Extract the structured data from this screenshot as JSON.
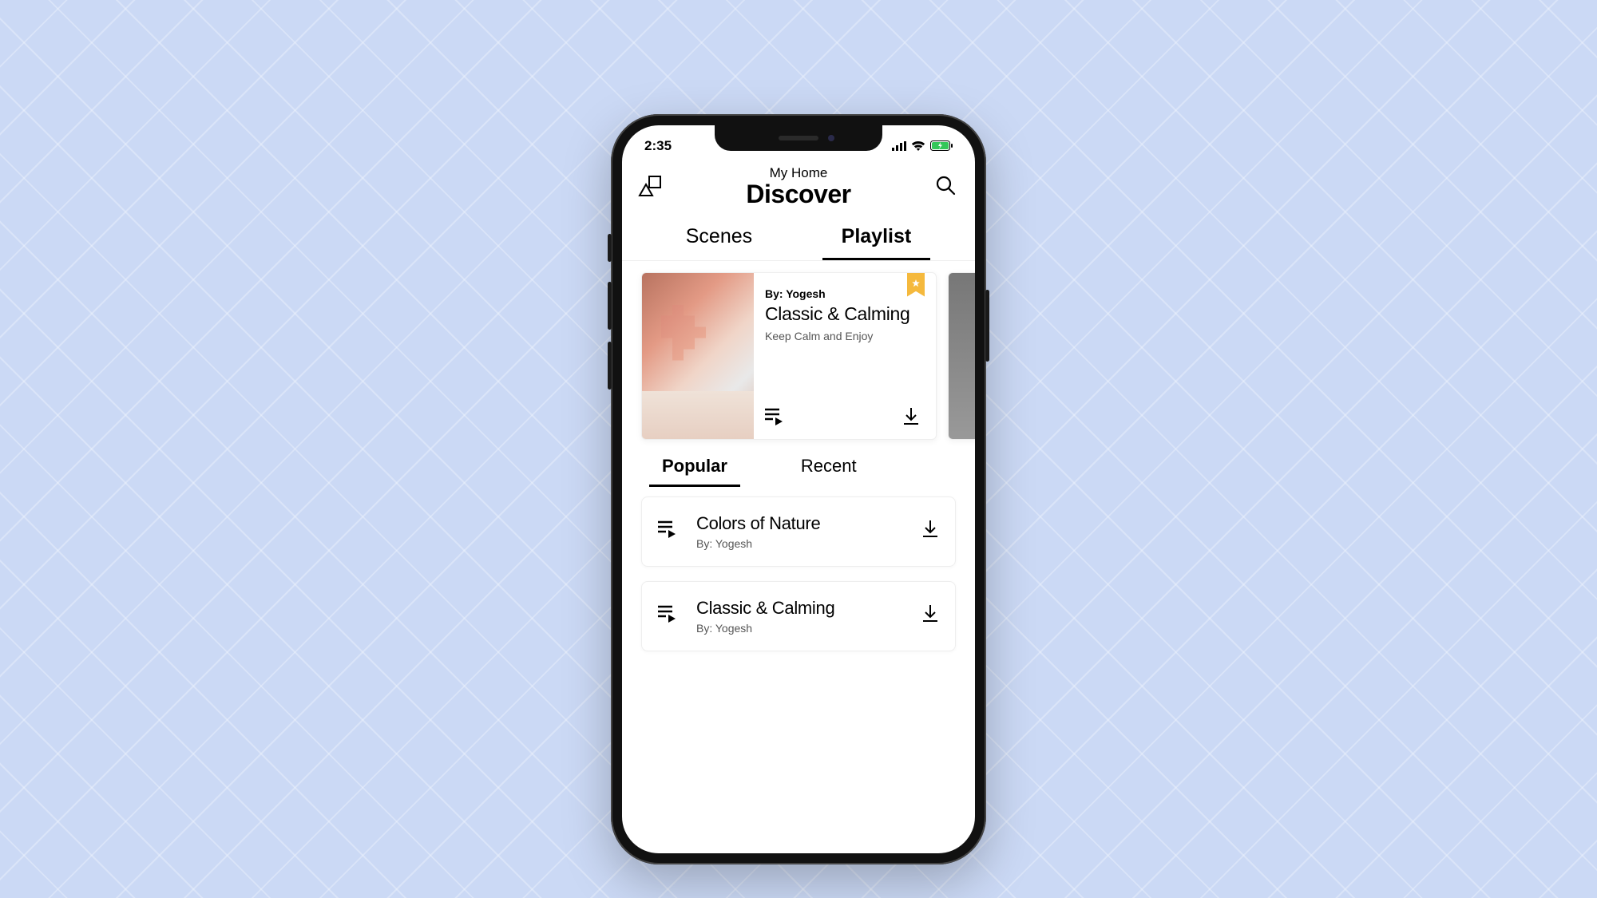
{
  "status": {
    "time": "2:35"
  },
  "header": {
    "subtitle": "My Home",
    "title": "Discover"
  },
  "tabs": {
    "scenes": "Scenes",
    "playlist": "Playlist",
    "active": "playlist"
  },
  "featured": {
    "by_label": "By: Yogesh",
    "title": "Classic & Calming",
    "subtitle": "Keep Calm and Enjoy"
  },
  "subtabs": {
    "popular": "Popular",
    "recent": "Recent",
    "active": "popular"
  },
  "list": {
    "items": [
      {
        "title": "Colors of Nature",
        "by": "By: Yogesh"
      },
      {
        "title": "Classic & Calming",
        "by": "By: Yogesh"
      }
    ]
  }
}
